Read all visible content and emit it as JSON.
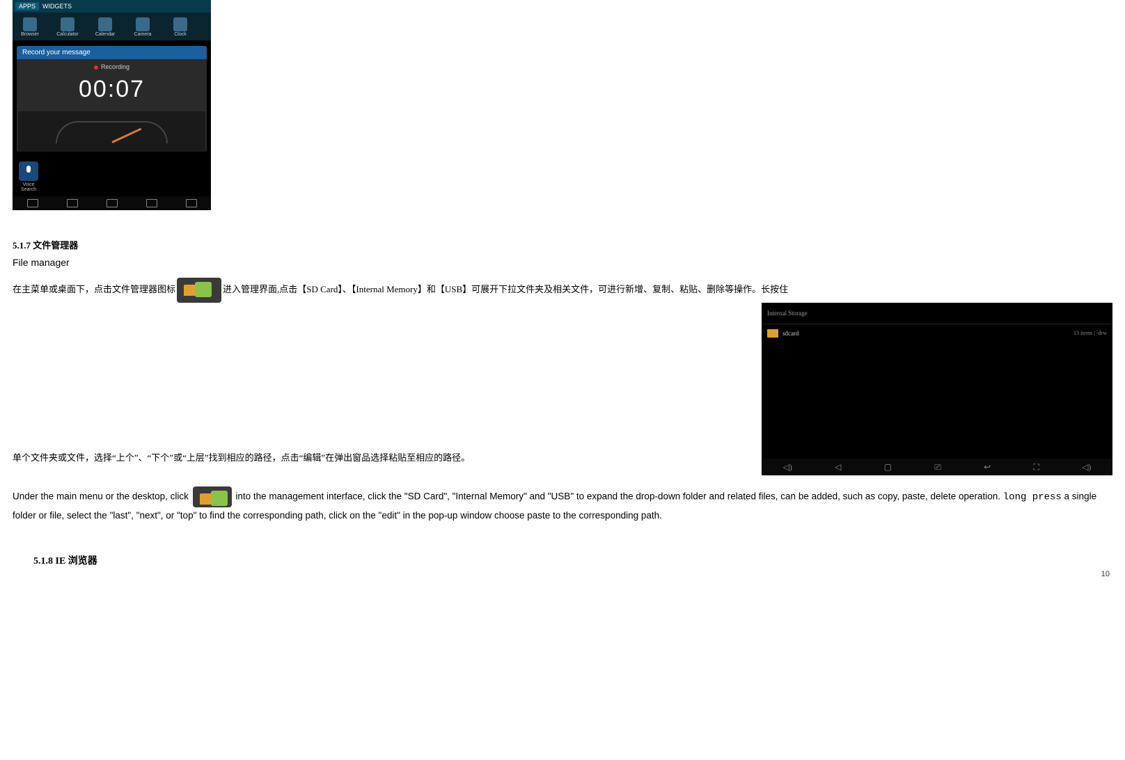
{
  "recorder": {
    "tabs": {
      "apps": "APPS",
      "widgets": "WIDGETS"
    },
    "apps": [
      "Browser",
      "Calculator",
      "Calendar",
      "Camera",
      "Clock"
    ],
    "window_title": "Record your message",
    "status": "Recording",
    "time": "00:07",
    "voice_search": "Voice\nSearch"
  },
  "section_517": {
    "heading": "5.1.7 文件管理器",
    "subtitle_en": "File manager",
    "zh_before_icon": "在主菜单或桌面下，点击文件管理器图标",
    "zh_after_icon": "进入管理界面,点击【SD Card】、【Internal Memory】和【USB】可展开下拉文件夹及相关文件，可进行新增、复制、粘贴、删除等操作。长按住",
    "zh_line2": "单个文件夹或文件，选择“上个”、“下个”或“上层”找到相应的路径，点击“编辑”在弹出窗品选择粘贴至相应的路径。",
    "en_before_icon": "Under the main menu or the desktop, click ",
    "en_after_icon": " into the management interface, click the \"SD Card\", \"Internal Memory\" and \"USB\" to expand the drop-down folder and related files, can be added, such as copy, paste, delete operation. ",
    "en_longpress": "long press",
    "en_tail": " a single folder or file, select the \"last\", \"next\", or \"top\" to find the corresponding path, click on the \"edit\" in the pop-up window choose paste to the corresponding path."
  },
  "fm_screenshot": {
    "header": "Internal Storage",
    "item": "sdcard",
    "meta": "13 items | -drw"
  },
  "section_518": {
    "heading": "5.1.8 IE 浏览器"
  },
  "page_number": "10"
}
